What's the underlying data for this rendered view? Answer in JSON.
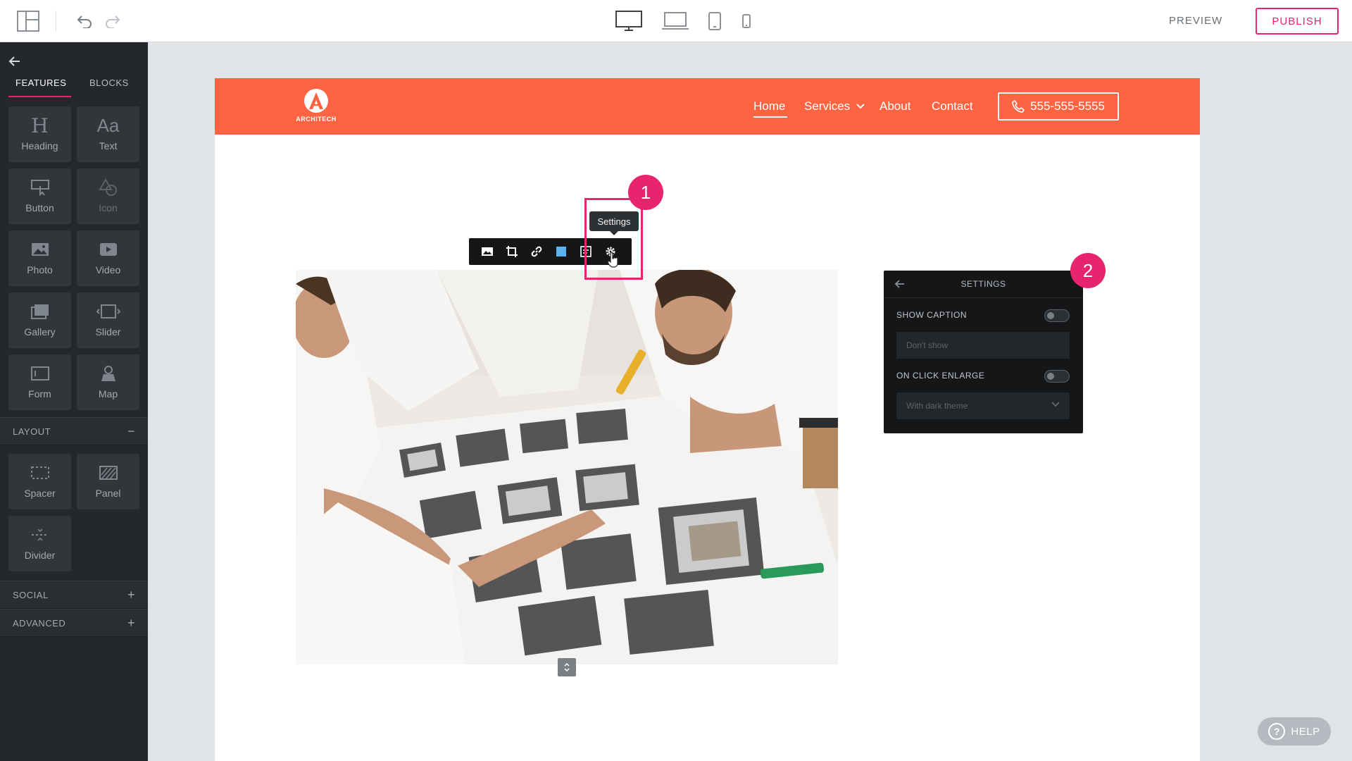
{
  "topbar": {
    "preview_label": "PREVIEW",
    "publish_label": "PUBLISH",
    "icons": [
      "layout-icon",
      "undo-icon",
      "redo-icon",
      "desktop-icon",
      "laptop-icon",
      "tablet-icon",
      "mobile-icon"
    ]
  },
  "sidebar": {
    "tabs": [
      {
        "label": "FEATURES",
        "active": true
      },
      {
        "label": "BLOCKS",
        "active": false
      }
    ],
    "features": [
      {
        "label": "Heading",
        "icon": "heading-icon",
        "glyph": "H",
        "enabled": true
      },
      {
        "label": "Text",
        "icon": "text-icon",
        "glyph": "Aa",
        "enabled": true
      },
      {
        "label": "Button",
        "icon": "button-icon",
        "enabled": true
      },
      {
        "label": "Icon",
        "icon": "shapes-icon",
        "enabled": false
      },
      {
        "label": "Photo",
        "icon": "photo-icon",
        "enabled": true
      },
      {
        "label": "Video",
        "icon": "video-icon",
        "enabled": true
      },
      {
        "label": "Gallery",
        "icon": "gallery-icon",
        "enabled": true
      },
      {
        "label": "Slider",
        "icon": "slider-icon",
        "enabled": true
      },
      {
        "label": "Form",
        "icon": "form-icon",
        "enabled": true
      },
      {
        "label": "Map",
        "icon": "map-icon",
        "enabled": true
      }
    ],
    "layout_section": {
      "label": "LAYOUT",
      "symbol": "−"
    },
    "layout_items": [
      {
        "label": "Spacer",
        "icon": "spacer-icon"
      },
      {
        "label": "Panel",
        "icon": "panel-icon"
      },
      {
        "label": "Divider",
        "icon": "divider-icon"
      }
    ],
    "social_section": {
      "label": "SOCIAL",
      "symbol": "+"
    },
    "advanced_section": {
      "label": "ADVANCED",
      "symbol": "+"
    }
  },
  "site": {
    "logo_text": "ARCHITECH",
    "nav": [
      {
        "label": "Home",
        "active": true
      },
      {
        "label": "Services",
        "dropdown": true
      },
      {
        "label": "About"
      },
      {
        "label": "Contact"
      }
    ],
    "phone": "555-555-5555",
    "brand_color": "#ff6442"
  },
  "image_toolbar": {
    "tools": [
      "replace-image-icon",
      "crop-icon",
      "link-icon",
      "color-icon",
      "caption-icon",
      "settings-gear-icon"
    ],
    "tooltip": "Settings"
  },
  "callouts": {
    "one": "1",
    "two": "2",
    "color": "#e8246f"
  },
  "settings_panel": {
    "title": "SETTINGS",
    "show_caption_label": "SHOW CAPTION",
    "show_caption_value": "Don't show",
    "on_click_enlarge_label": "ON CLICK ENLARGE",
    "on_click_enlarge_value": "With dark theme"
  },
  "help": {
    "label": "HELP"
  }
}
